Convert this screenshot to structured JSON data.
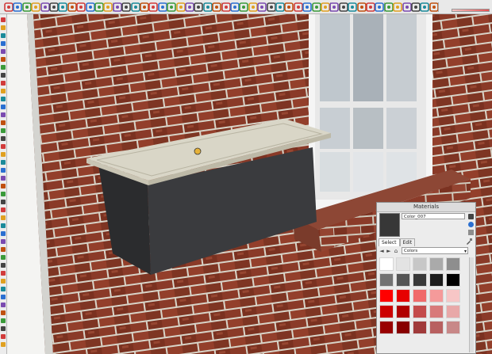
{
  "toolbar": {
    "icons": [
      "eraser-icon",
      "pencil-icon",
      "rectangle-icon",
      "circle-icon",
      "arc-icon",
      "polygon-icon",
      "push-pull-icon",
      "move-icon",
      "rotate-icon",
      "follow-me-icon",
      "scale-icon",
      "offset-icon",
      "tape-measure-icon",
      "dimension-icon",
      "protractor-icon",
      "text-icon",
      "axes-icon",
      "3d-text-icon",
      "paint-bucket-icon",
      "orbit-icon",
      "pan-icon",
      "zoom-icon",
      "zoom-window-icon",
      "zoom-extents-icon",
      "previous-view-icon",
      "next-view-icon",
      "position-camera-icon",
      "walk-icon",
      "look-around-icon",
      "section-plane-icon",
      "iso-view-icon",
      "top-view-icon",
      "front-view-icon",
      "right-view-icon",
      "back-view-icon",
      "left-view-icon",
      "xray-icon",
      "wireframe-icon",
      "hidden-line-icon",
      "shaded-icon",
      "shaded-textures-icon",
      "monochrome-icon",
      "3d-warehouse-icon",
      "share-model-icon",
      "extension-warehouse-icon",
      "layout-icon",
      "shadows-icon",
      "fog-icon"
    ]
  },
  "materials": {
    "title": "Materials",
    "current_material": "Color_007",
    "current_color": "#373737",
    "tabs": [
      "Select",
      "Edit"
    ],
    "active_tab": "Select",
    "collection": "Colors",
    "swatches": [
      [
        "#ffffff",
        "#e3e3e3",
        "#c7c7c7",
        "#aaaaaa",
        "#8e8e8e"
      ],
      [
        "#727272",
        "#555555",
        "#393939",
        "#1c1c1c",
        "#000000"
      ],
      [
        "#ff0000",
        "#e60000",
        "#f06a6a",
        "#f59a9a",
        "#f7c6c6"
      ],
      [
        "#cc0000",
        "#b00000",
        "#c44b4b",
        "#d87a7a",
        "#e8a8a8"
      ],
      [
        "#990000",
        "#880000",
        "#a03a3a",
        "#b86060",
        "#c88888"
      ]
    ]
  }
}
